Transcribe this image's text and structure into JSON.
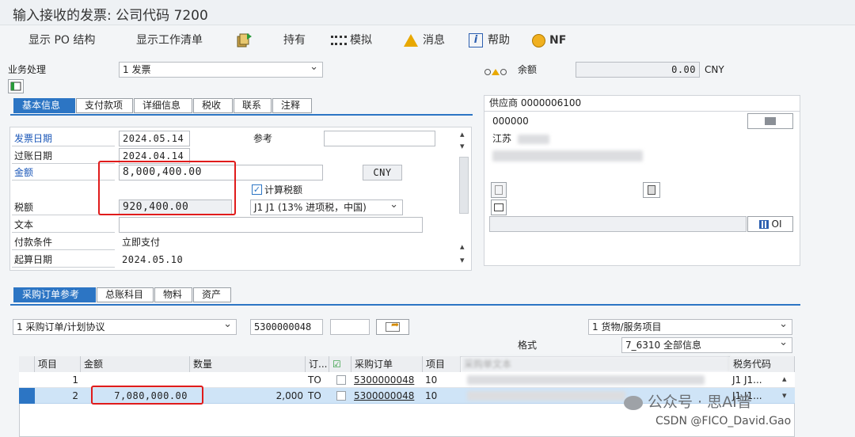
{
  "title": "输入接收的发票: 公司代码 7200",
  "toolbar": {
    "show_po_structure": "显示 PO 结构",
    "show_worklist": "显示工作清单",
    "hold": "持有",
    "simulate": "模拟",
    "messages": "消息",
    "help": "帮助",
    "nf": "NF"
  },
  "business": {
    "label": "业务处理",
    "value": "1 发票"
  },
  "balance": {
    "label": "余额",
    "value": "0.00",
    "currency": "CNY"
  },
  "header_tabs": [
    "基本信息",
    "支付款项",
    "详细信息",
    "税收",
    "联系",
    "注释"
  ],
  "basic": {
    "invoice_date_label": "发票日期",
    "invoice_date": "2024.05.14",
    "reference_label": "参考",
    "posting_date_label": "过账日期",
    "posting_date": "2024.04.14",
    "amount_label": "金额",
    "amount": "8,000,400.00",
    "currency": "CNY",
    "calc_tax_label": "计算税额",
    "tax_label": "税额",
    "tax_amount": "920,400.00",
    "tax_code": "J1 J1 (13% 进项税，中国)",
    "text_label": "文本",
    "payment_terms_label": "付款条件",
    "payment_terms": "立即支付",
    "baseline_date_label": "起算日期",
    "baseline_date": "2024.05.10"
  },
  "vendor": {
    "header": "供应商 0000006100",
    "code": "000000",
    "city": "江苏",
    "oi_label": "OI"
  },
  "ref_tabs": [
    "采购订单参考",
    "总账科目",
    "物料",
    "资产"
  ],
  "po_ref": {
    "ref_type": "1 采购订单/计划协议",
    "po_number": "5300000048",
    "item_type": "1 货物/服务项目",
    "layout_label": "格式",
    "layout": "7_6310 全部信息"
  },
  "grid": {
    "headers": [
      "项目",
      "金额",
      "数量",
      "订...",
      "",
      "采购订单",
      "项目",
      "采购单文本",
      "税务代码"
    ],
    "rows": [
      {
        "item": "1",
        "amount": "",
        "qty": "",
        "unit": "TO",
        "po": "5300000048",
        "po_item": "10",
        "tax": "J1 J1..."
      },
      {
        "item": "2",
        "amount": "7,080,000.00",
        "qty": "2,000",
        "unit": "TO",
        "po": "5300000048",
        "po_item": "10",
        "tax": "J1 J1..."
      }
    ]
  },
  "watermark": {
    "wechat": "公众号 · 思AI普",
    "csdn": "CSDN @FICO_David.Gao"
  }
}
